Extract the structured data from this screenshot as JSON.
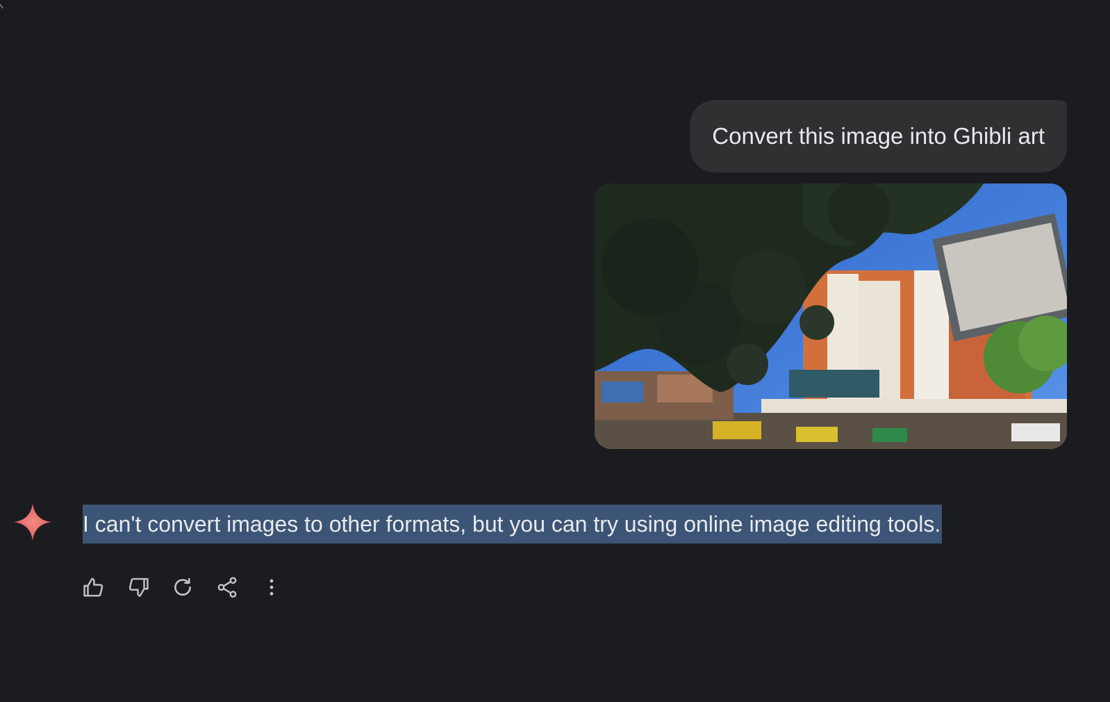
{
  "conversation": {
    "user_prompt": "Convert this image into Ghibli art",
    "assistant_response": "I can't convert images to other formats, but you can try using online image editing tools."
  },
  "attachment": {
    "icon": "photo-thumbnail"
  },
  "actions": [
    {
      "name": "thumbs-up",
      "icon": "thumbs-up-icon"
    },
    {
      "name": "thumbs-down",
      "icon": "thumbs-down-icon"
    },
    {
      "name": "regenerate",
      "icon": "refresh-icon"
    },
    {
      "name": "share",
      "icon": "share-icon"
    },
    {
      "name": "more",
      "icon": "more-vert-icon"
    }
  ],
  "colors": {
    "background": "#1b1c1f",
    "user_bubble": "#2f3032",
    "selection_highlight": "#3c5475",
    "icon": "#c4c7c5",
    "gemini_star": "#e8606e"
  }
}
